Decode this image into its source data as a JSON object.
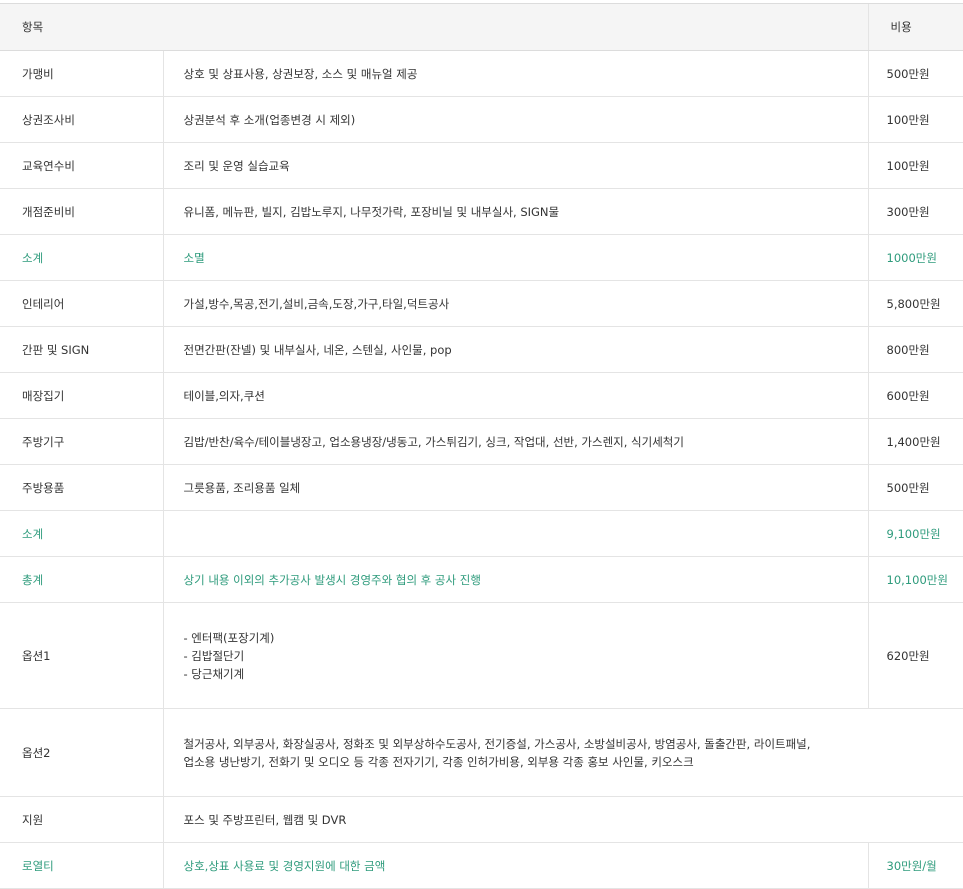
{
  "header": {
    "item": "항목",
    "cost": "비용"
  },
  "rows": [
    {
      "item": "가맹비",
      "desc": "상호 및 상표사용, 상권보장, 소스 및 매뉴얼 제공",
      "cost": "500만원"
    },
    {
      "item": "상권조사비",
      "desc": "상권분석 후 소개(업종변경 시 제외)",
      "cost": "100만원"
    },
    {
      "item": "교육연수비",
      "desc": "조리 및 운영 실습교육",
      "cost": "100만원"
    },
    {
      "item": "개점준비비",
      "desc": "유니폼, 메뉴판, 빌지, 김밥노루지, 나무젓가락, 포장비닐 및 내부실사, SIGN물",
      "cost": "300만원"
    },
    {
      "item": "소계",
      "desc": "소멸",
      "cost": "1000만원"
    },
    {
      "item": "인테리어",
      "desc": "가설,방수,목공,전기,설비,금속,도장,가구,타일,덕트공사",
      "cost": "5,800만원"
    },
    {
      "item": "간판 및 SIGN",
      "desc": "전면간판(잔넬) 및 내부실사, 네온, 스텐실, 사인물, pop",
      "cost": "800만원"
    },
    {
      "item": "매장집기",
      "desc": "테이블,의자,쿠션",
      "cost": "600만원"
    },
    {
      "item": "주방기구",
      "desc": "김밥/반찬/육수/테이블냉장고, 업소용냉장/냉동고, 가스튀김기, 싱크, 작업대, 선반, 가스렌지, 식기세척기",
      "cost": "1,400만원"
    },
    {
      "item": "주방용품",
      "desc": "그릇용품, 조리용품 일체",
      "cost": "500만원"
    },
    {
      "item": "소계",
      "desc": "",
      "cost": "9,100만원"
    },
    {
      "item": "총계",
      "desc": "상기 내용 이외의 추가공사 발생시 경영주와 협의 후 공사 진행",
      "cost": "10,100만원"
    },
    {
      "item": "옵션1",
      "lines": [
        "- 엔터팩(포장기계)",
        "- 김밥절단기",
        "- 당근채기계"
      ],
      "cost": "620만원"
    },
    {
      "item": "옵션2",
      "lines": [
        "철거공사, 외부공사, 화장실공사, 정화조 및 외부상하수도공사, 전기증설, 가스공사, 소방설비공사, 방염공사, 돌출간판, 라이트패널,",
        "업소용 냉난방기, 전화기 및 오디오 등 각종 전자기기, 각종 인허가비용, 외부용 각종 홍보 사인물, 키오스크"
      ]
    },
    {
      "item": "지원",
      "desc": "포스 및 주방프린터, 웹캠 및 DVR"
    },
    {
      "item": "로열티",
      "desc": "상호,상표 사용료 및 경영지원에 대한 금액",
      "cost": "30만원/월"
    }
  ],
  "colors": {
    "accent": "#2e9b7c",
    "header_bg": "#f5f5f5",
    "border": "#e4e4e4"
  }
}
